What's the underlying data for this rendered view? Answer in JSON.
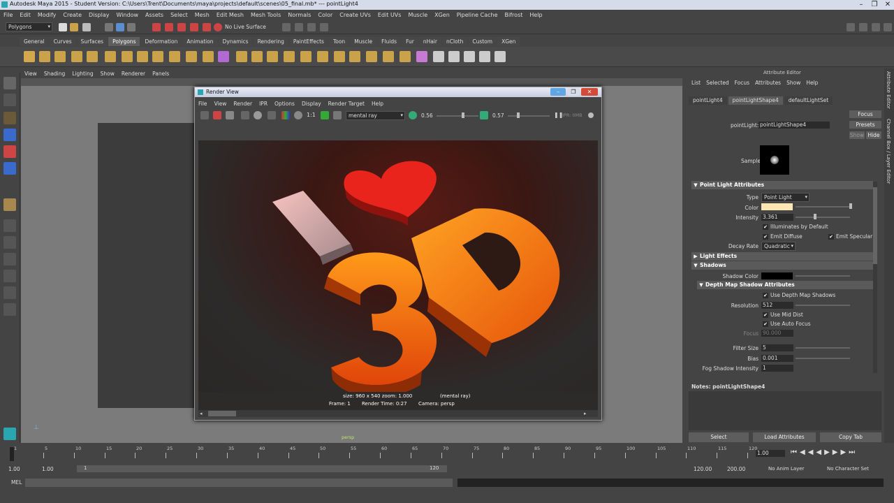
{
  "window": {
    "title": "Autodesk Maya 2015 - Student Version: C:\\Users\\Trent\\Documents\\maya\\projects\\default\\scenes\\05_final.mb*   ---   pointLight4",
    "controls": [
      "–",
      "❐",
      "✕"
    ]
  },
  "menus": [
    "File",
    "Edit",
    "Modify",
    "Create",
    "Display",
    "Window",
    "Assets",
    "Select",
    "Mesh",
    "Edit Mesh",
    "Mesh Tools",
    "Normals",
    "Color",
    "Create UVs",
    "Edit UVs",
    "Muscle",
    "XGen",
    "Pipeline Cache",
    "Bifrost",
    "Help"
  ],
  "statusline": {
    "mode": "Polygons",
    "live_surface": "No Live Surface"
  },
  "shelf_tabs": [
    "General",
    "Curves",
    "Surfaces",
    "Polygons",
    "Deformation",
    "Animation",
    "Dynamics",
    "Rendering",
    "PaintEffects",
    "Toon",
    "Muscle",
    "Fluids",
    "Fur",
    "nHair",
    "nCloth",
    "Custom",
    "XGen"
  ],
  "shelf_active": "Polygons",
  "viewport": {
    "menus": [
      "View",
      "Shading",
      "Lighting",
      "Show",
      "Renderer",
      "Panels"
    ],
    "camera_label": "persp"
  },
  "render_view": {
    "title": "Render View",
    "menus": [
      "File",
      "View",
      "Render",
      "IPR",
      "Options",
      "Display",
      "Render Target",
      "Help"
    ],
    "renderer": "mental ray",
    "exposure": "0.56",
    "gamma": "0.57",
    "ipr_label": "IPR: 0MB",
    "ratio": "1:1",
    "info": {
      "size": "size: 960 x 540  zoom: 1.000",
      "renderer": "(mental ray)",
      "frame": "Frame: 1",
      "render_time": "Render Time: 0:27",
      "camera": "Camera: persp"
    }
  },
  "attribute_editor": {
    "title": "Attribute Editor",
    "menus": [
      "List",
      "Selected",
      "Focus",
      "Attributes",
      "Show",
      "Help"
    ],
    "tabs": [
      "pointLight4",
      "pointLightShape4",
      "defaultLightSet"
    ],
    "active_tab": "pointLightShape4",
    "buttons": {
      "focus": "Focus",
      "presets": "Presets",
      "show": "Show",
      "hide": "Hide"
    },
    "node_label": "pointLight:",
    "node_value": "pointLightShape4",
    "sample_label": "Sample",
    "sections": {
      "point_light": "Point Light Attributes",
      "light_effects": "Light Effects",
      "shadows": "Shadows",
      "depth_map": "Depth Map Shadow Attributes"
    },
    "attrs": {
      "type_label": "Type",
      "type_value": "Point Light",
      "color_label": "Color",
      "color_value": "#fbe6b4",
      "intensity_label": "Intensity",
      "intensity_value": "3.361",
      "illum_default": "Illuminates by Default",
      "emit_diffuse": "Emit Diffuse",
      "emit_specular": "Emit Specular",
      "decay_label": "Decay Rate",
      "decay_value": "Quadratic",
      "shadow_color_label": "Shadow Color",
      "use_dm": "Use Depth Map Shadows",
      "resolution_label": "Resolution",
      "resolution_value": "512",
      "use_mid": "Use Mid Dist",
      "use_auto": "Use Auto Focus",
      "focus_label": "Focus",
      "focus_value": "90.000",
      "filter_label": "Filter Size",
      "filter_value": "5",
      "bias_label": "Bias",
      "bias_value": "0.001",
      "fog_label": "Fog Shadow Intensity",
      "fog_value": "1"
    },
    "notes": "Notes:  pointLightShape4",
    "bottom_buttons": [
      "Select",
      "Load Attributes",
      "Copy Tab"
    ],
    "side_tabs": [
      "Attribute Editor",
      "Channel Box / Layer Editor"
    ]
  },
  "timeline": {
    "ticks": [
      "1",
      "5",
      "10",
      "15",
      "20",
      "25",
      "30",
      "35",
      "40",
      "45",
      "50",
      "55",
      "60",
      "65",
      "70",
      "75",
      "80",
      "85",
      "90",
      "95",
      "100",
      "105",
      "110",
      "115",
      "120"
    ],
    "current": "1.00"
  },
  "range": {
    "start": "1.00",
    "start2": "1.00",
    "slider_start": "1",
    "slider_end": "120",
    "end": "120.00",
    "end2": "200.00",
    "anim_layer": "No Anim Layer",
    "char_set": "No Character Set"
  },
  "cmdline": {
    "label": "MEL"
  }
}
